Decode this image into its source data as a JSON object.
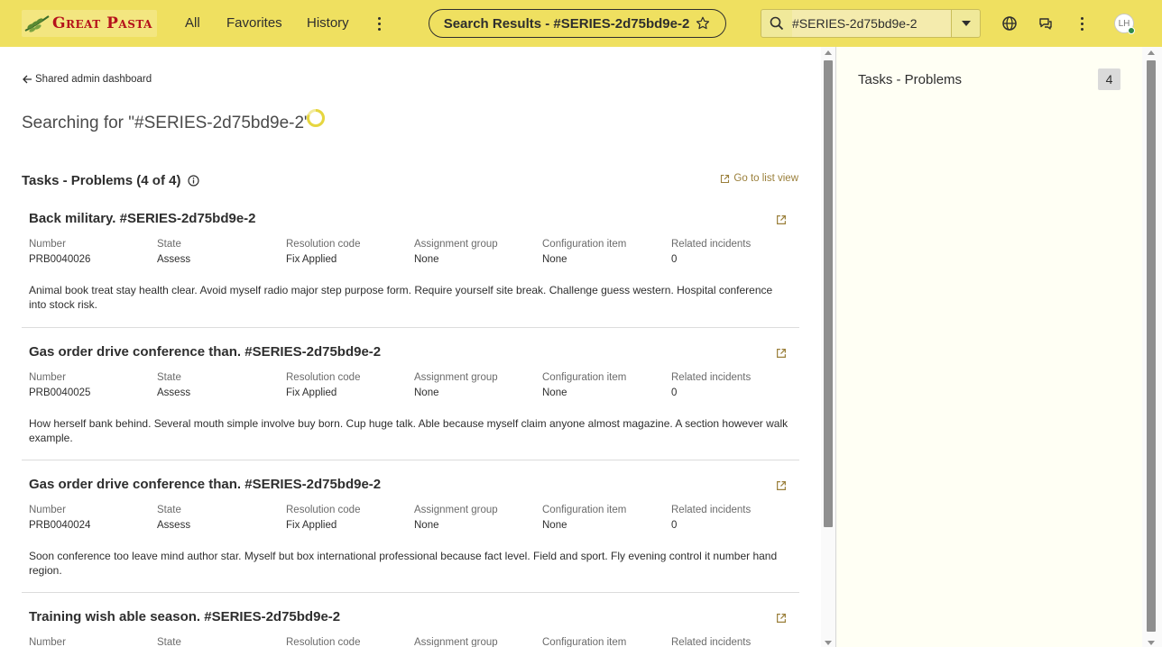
{
  "header": {
    "logo_text": "Great Pasta",
    "nav": [
      "All",
      "Favorites",
      "History"
    ],
    "page_title": "Search Results - #SERIES-2d75bd9e-2",
    "search_value": "#SERIES-2d75bd9e-2",
    "avatar_initials": "LH"
  },
  "main": {
    "back_label": "Shared admin dashboard",
    "searching_label": "Searching for \"#SERIES-2d75bd9e-2\"",
    "section_title": "Tasks - Problems (4 of 4)",
    "list_link": "Go to list view",
    "field_labels": [
      "Number",
      "State",
      "Resolution code",
      "Assignment group",
      "Configuration item",
      "Related incidents"
    ],
    "cards": [
      {
        "title": "Back military. #SERIES-2d75bd9e-2",
        "values": [
          "PRB0040026",
          "Assess",
          "Fix Applied",
          "None",
          "None",
          "0"
        ],
        "description": "Animal book treat stay health clear. Avoid myself radio major step purpose form. Require yourself site break. Challenge guess western. Hospital conference into stock risk."
      },
      {
        "title": "Gas order drive conference than. #SERIES-2d75bd9e-2",
        "values": [
          "PRB0040025",
          "Assess",
          "Fix Applied",
          "None",
          "None",
          "0"
        ],
        "description": "How herself bank behind. Several mouth simple involve buy born. Cup huge talk. Able because myself claim anyone almost magazine. A section however walk example."
      },
      {
        "title": "Gas order drive conference than. #SERIES-2d75bd9e-2",
        "values": [
          "PRB0040024",
          "Assess",
          "Fix Applied",
          "None",
          "None",
          "0"
        ],
        "description": "Soon conference too leave mind author star. Myself but box international professional because fact level. Field and sport. Fly evening control it number hand region."
      },
      {
        "title": "Training wish able season. #SERIES-2d75bd9e-2",
        "values": [
          "",
          "",
          "",
          "",
          "",
          ""
        ],
        "description": ""
      }
    ]
  },
  "side": {
    "title": "Tasks - Problems",
    "count": "4"
  }
}
